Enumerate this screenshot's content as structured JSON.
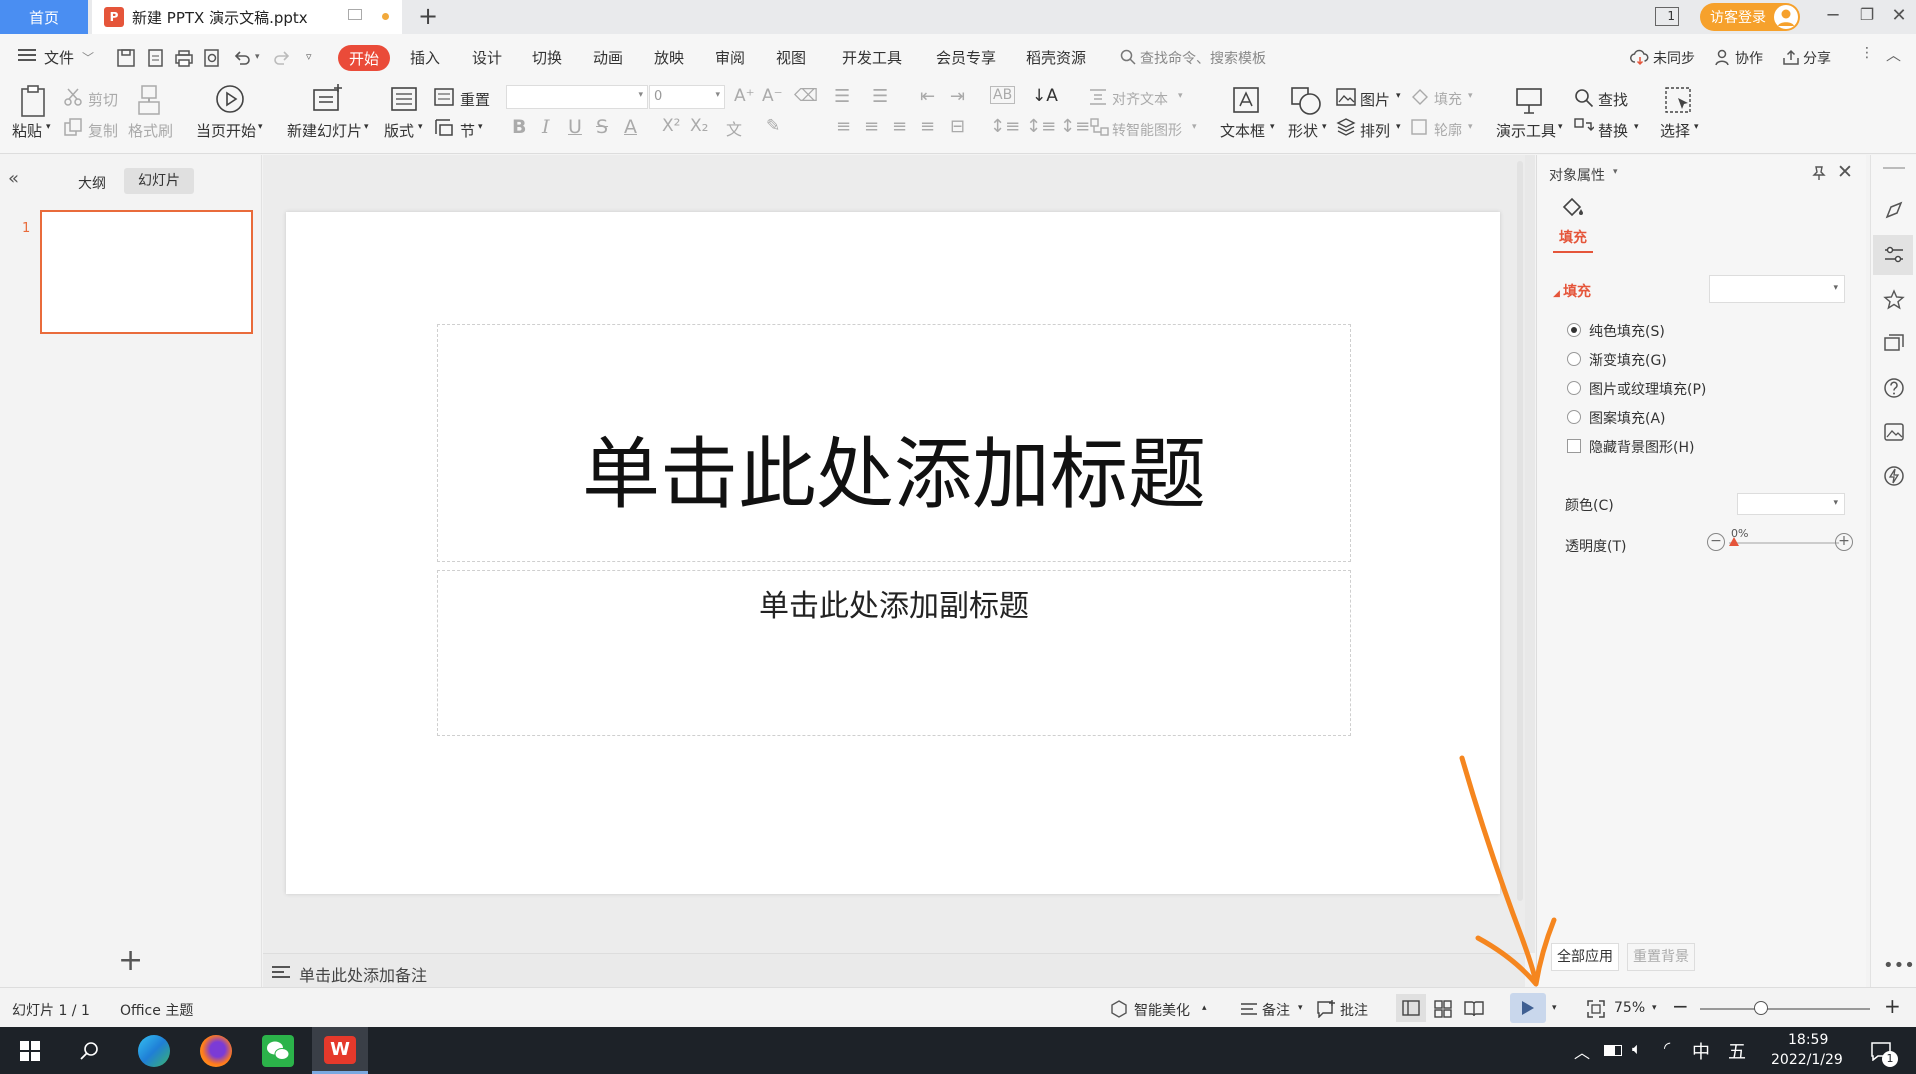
{
  "titlebar": {
    "home_tab": "首页",
    "doc_tab": "新建 PPTX 演示文稿.pptx",
    "doc_badge": "P",
    "new_tab": "+",
    "login": "访客登录",
    "page_indicator": "1"
  },
  "menubar": {
    "file": "文件",
    "tabs": [
      "开始",
      "插入",
      "设计",
      "切换",
      "动画",
      "放映",
      "审阅",
      "视图",
      "开发工具",
      "会员专享",
      "稻壳资源"
    ],
    "search_placeholder": "查找命令、搜索模板",
    "sync": "未同步",
    "collab": "协作",
    "share": "分享"
  },
  "ribbon": {
    "paste": "粘贴",
    "cut": "剪切",
    "copy": "复制",
    "format_painter": "格式刷",
    "play_from_current": "当页开始",
    "new_slide": "新建幻灯片",
    "layout": "版式",
    "reset": "重置",
    "section": "节",
    "font_size": "0",
    "align_text": "对齐文本",
    "smartart": "转智能图形",
    "textbox": "文本框",
    "shape": "形状",
    "picture": "图片",
    "arrange": "排列",
    "fill": "填充",
    "outline": "轮廓",
    "presentation_tools": "演示工具",
    "find": "查找",
    "replace": "替换",
    "select": "选择"
  },
  "leftpanel": {
    "outline_tab": "大纲",
    "slides_tab": "幻灯片",
    "slide_number": "1",
    "add": "+"
  },
  "slide": {
    "title_placeholder": "单击此处添加标题",
    "subtitle_placeholder": "单击此处添加副标题"
  },
  "notes": {
    "placeholder": "单击此处添加备注"
  },
  "rightpanel": {
    "header": "对象属性",
    "fill_tab": "填充",
    "section_fill": "填充",
    "options": [
      "纯色填充(S)",
      "渐变填充(G)",
      "图片或纹理填充(P)",
      "图案填充(A)"
    ],
    "selected_option": 0,
    "hide_bg": "隐藏背景图形(H)",
    "color_label": "颜色(C)",
    "transparency_label": "透明度(T)",
    "transparency_value": "0%",
    "apply_all": "全部应用",
    "reset_bg": "重置背景"
  },
  "statusbar": {
    "slide_count": "幻灯片 1 / 1",
    "theme": "Office 主题",
    "beautify": "智能美化",
    "notes": "备注",
    "comments": "批注",
    "zoom": "75%"
  },
  "taskbar": {
    "time": "18:59",
    "date": "2022/1/29",
    "ime_lang": "中",
    "ime_mode": "五",
    "notif_count": "1"
  },
  "colors": {
    "accent_red": "#ea4b39",
    "home_tab_blue": "#4a8ef2",
    "thumb_border": "#e96b3b",
    "annotation_orange": "#f5861f"
  }
}
